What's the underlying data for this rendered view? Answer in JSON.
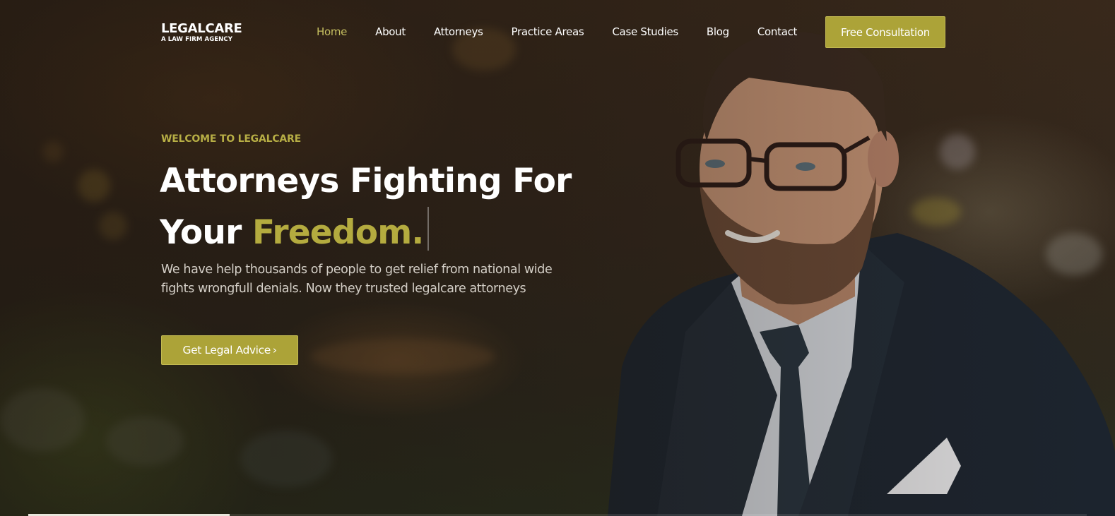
{
  "brand": {
    "title": "LEGALCARE",
    "subtitle": "A LAW FIRM AGENCY"
  },
  "nav": {
    "items": [
      {
        "label": "Home",
        "active": true
      },
      {
        "label": "About",
        "active": false
      },
      {
        "label": "Attorneys",
        "active": false
      },
      {
        "label": "Practice Areas",
        "active": false
      },
      {
        "label": "Case Studies",
        "active": false
      },
      {
        "label": "Blog",
        "active": false
      },
      {
        "label": "Contact",
        "active": false
      }
    ],
    "cta_label": "Free Consultation"
  },
  "hero": {
    "eyebrow": "WELCOME TO LEGALCARE",
    "headline_line1": "Attorneys Fighting For",
    "headline_line2_plain": "Your",
    "headline_line2_accent": "Freedom.",
    "description": "We have help thousands of people to get relief from national wide fights wrongfull denials. Now they trusted legalcare attorneys",
    "button_label": "Get Legal Advice",
    "button_icon": "chevron-right-icon",
    "slide_progress_percent": 19
  },
  "colors": {
    "accent": "#aca338",
    "accent_text": "#b4ab3f",
    "active_nav": "#c6bf60",
    "text": "#ffffff"
  }
}
